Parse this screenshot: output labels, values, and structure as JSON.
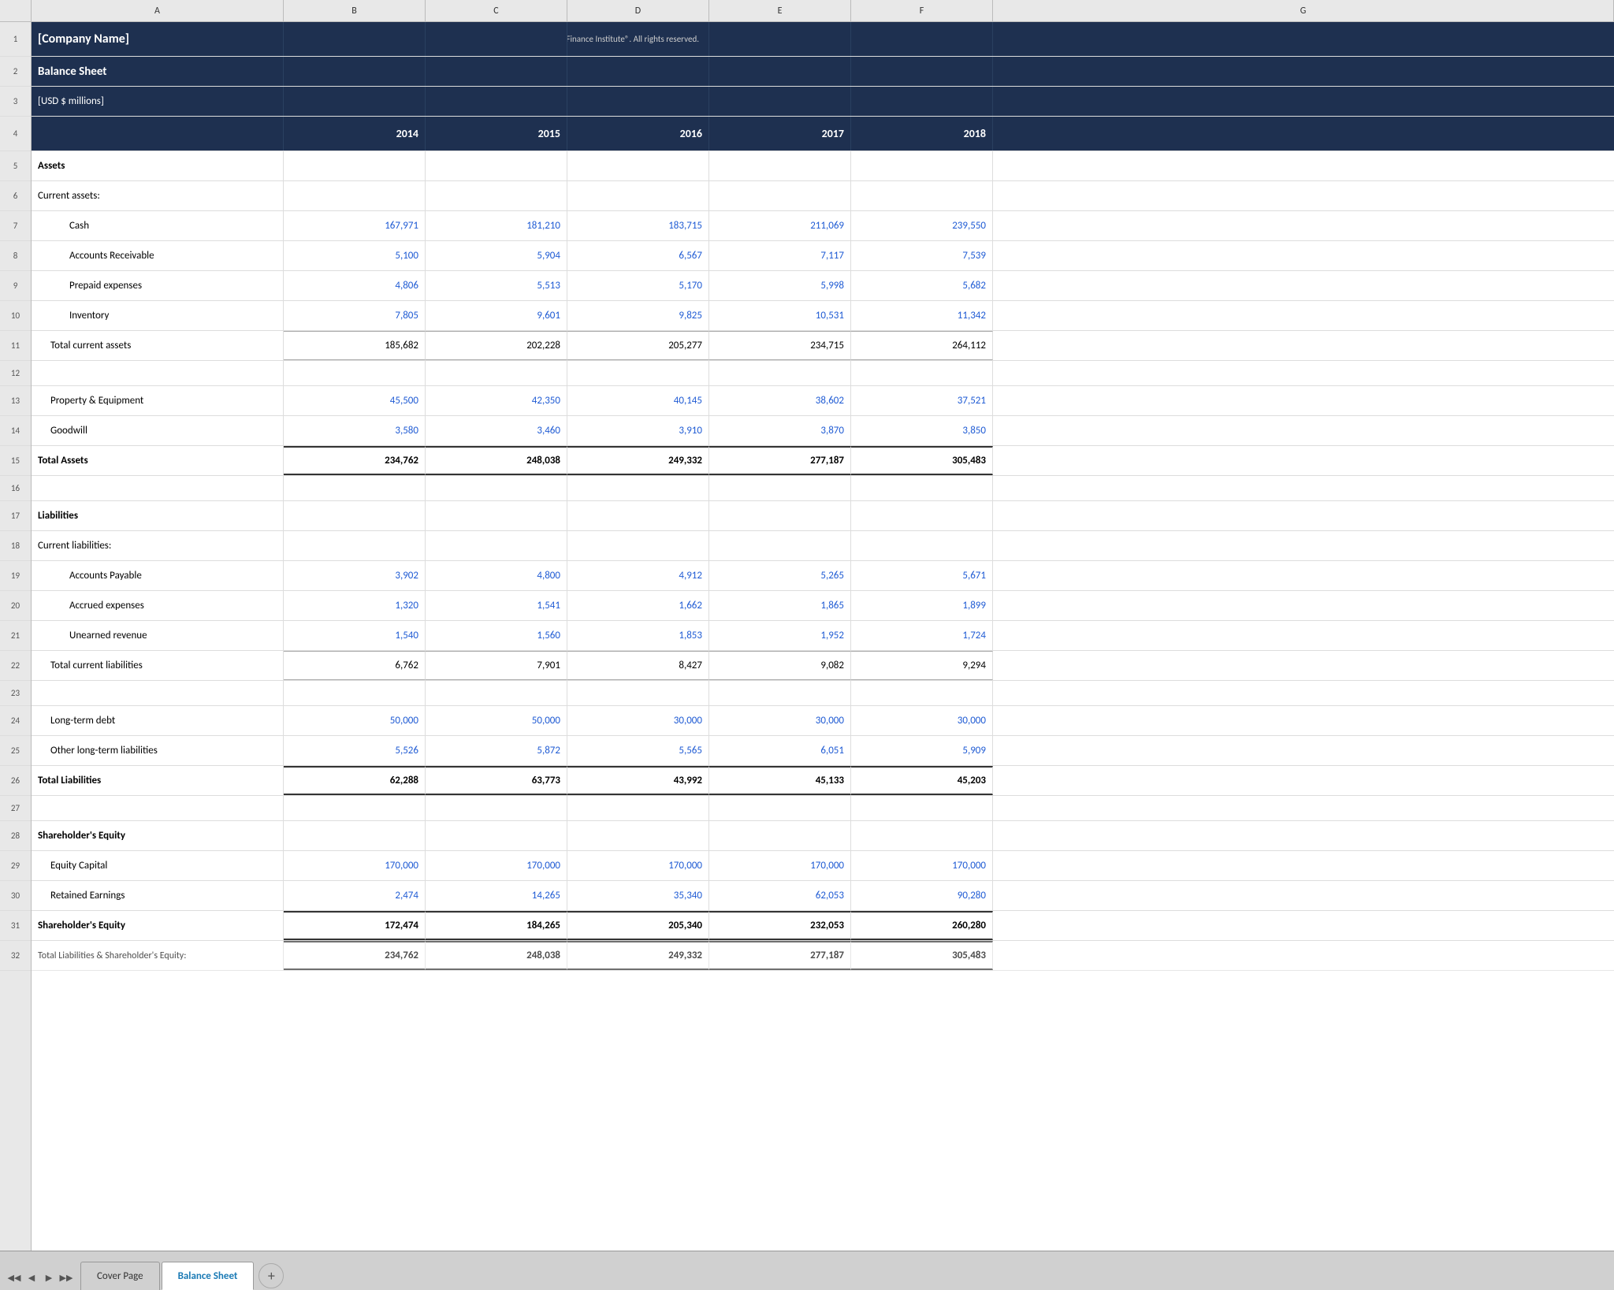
{
  "company": {
    "name": "[Company Name]",
    "copyright": "© Corporate Finance Institute®. All rights reserved.",
    "title": "Balance Sheet",
    "currency": "[USD $ millions]"
  },
  "columns": {
    "headers": [
      "A",
      "B",
      "C",
      "D",
      "E",
      "F",
      "G"
    ],
    "years": [
      "2014",
      "2015",
      "2016",
      "2017",
      "2018"
    ]
  },
  "rows": [
    {
      "num": "1",
      "height": "h-row-1"
    },
    {
      "num": "2",
      "height": "h-row-2"
    },
    {
      "num": "3",
      "height": "h-row-3"
    },
    {
      "num": "4",
      "height": "h-row-4"
    },
    {
      "num": "5",
      "height": "h-row-default"
    },
    {
      "num": "6",
      "height": "h-row-default"
    },
    {
      "num": "7",
      "height": "h-row-default"
    },
    {
      "num": "8",
      "height": "h-row-default"
    },
    {
      "num": "9",
      "height": "h-row-default"
    },
    {
      "num": "10",
      "height": "h-row-default"
    },
    {
      "num": "11",
      "height": "h-row-default"
    },
    {
      "num": "12",
      "height": "h-row-empty"
    },
    {
      "num": "13",
      "height": "h-row-default"
    },
    {
      "num": "14",
      "height": "h-row-default"
    },
    {
      "num": "15",
      "height": "h-row-default"
    },
    {
      "num": "16",
      "height": "h-row-empty"
    },
    {
      "num": "17",
      "height": "h-row-default"
    },
    {
      "num": "18",
      "height": "h-row-default"
    },
    {
      "num": "19",
      "height": "h-row-default"
    },
    {
      "num": "20",
      "height": "h-row-default"
    },
    {
      "num": "21",
      "height": "h-row-default"
    },
    {
      "num": "22",
      "height": "h-row-default"
    },
    {
      "num": "23",
      "height": "h-row-empty"
    },
    {
      "num": "24",
      "height": "h-row-default"
    },
    {
      "num": "25",
      "height": "h-row-default"
    },
    {
      "num": "26",
      "height": "h-row-default"
    },
    {
      "num": "27",
      "height": "h-row-empty"
    },
    {
      "num": "28",
      "height": "h-row-default"
    },
    {
      "num": "29",
      "height": "h-row-default"
    },
    {
      "num": "30",
      "height": "h-row-default"
    },
    {
      "num": "31",
      "height": "h-row-default"
    },
    {
      "num": "32",
      "height": "h-row-default"
    }
  ],
  "data": {
    "assets_label": "Assets",
    "current_assets_label": "Current assets:",
    "cash_label": "Cash",
    "ar_label": "Accounts Receivable",
    "prepaid_label": "Prepaid expenses",
    "inventory_label": "Inventory",
    "total_current_assets_label": "Total current assets",
    "ppe_label": "Property & Equipment",
    "goodwill_label": "Goodwill",
    "total_assets_label": "Total Assets",
    "liabilities_label": "Liabilities",
    "current_liabilities_label": "Current liabilities:",
    "ap_label": "Accounts Payable",
    "accrued_label": "Accrued expenses",
    "unearned_label": "Unearned revenue",
    "total_current_liabilities_label": "Total current liabilities",
    "ltd_label": "Long-term debt",
    "other_ltd_label": "Other long-term liabilities",
    "total_liabilities_label": "Total Liabilities",
    "se_heading_label": "Shareholder's Equity",
    "equity_capital_label": "Equity Capital",
    "retained_earnings_label": "Retained Earnings",
    "se_total_label": "Shareholder's Equity",
    "total_le_label": "Total Liabilities & Shareholder's Equity:",
    "cash": [
      "167,971",
      "181,210",
      "183,715",
      "211,069",
      "239,550"
    ],
    "ar": [
      "5,100",
      "5,904",
      "6,567",
      "7,117",
      "7,539"
    ],
    "prepaid": [
      "4,806",
      "5,513",
      "5,170",
      "5,998",
      "5,682"
    ],
    "inventory": [
      "7,805",
      "9,601",
      "9,825",
      "10,531",
      "11,342"
    ],
    "total_current_assets": [
      "185,682",
      "202,228",
      "205,277",
      "234,715",
      "264,112"
    ],
    "ppe": [
      "45,500",
      "42,350",
      "40,145",
      "38,602",
      "37,521"
    ],
    "goodwill": [
      "3,580",
      "3,460",
      "3,910",
      "3,870",
      "3,850"
    ],
    "total_assets": [
      "234,762",
      "248,038",
      "249,332",
      "277,187",
      "305,483"
    ],
    "ap": [
      "3,902",
      "4,800",
      "4,912",
      "5,265",
      "5,671"
    ],
    "accrued": [
      "1,320",
      "1,541",
      "1,662",
      "1,865",
      "1,899"
    ],
    "unearned": [
      "1,540",
      "1,560",
      "1,853",
      "1,952",
      "1,724"
    ],
    "total_current_liabilities": [
      "6,762",
      "7,901",
      "8,427",
      "9,082",
      "9,294"
    ],
    "ltd": [
      "50,000",
      "50,000",
      "30,000",
      "30,000",
      "30,000"
    ],
    "other_ltd": [
      "5,526",
      "5,872",
      "5,565",
      "6,051",
      "5,909"
    ],
    "total_liabilities": [
      "62,288",
      "63,773",
      "43,992",
      "45,133",
      "45,203"
    ],
    "equity_capital": [
      "170,000",
      "170,000",
      "170,000",
      "170,000",
      "170,000"
    ],
    "retained_earnings": [
      "2,474",
      "14,265",
      "35,340",
      "62,053",
      "90,280"
    ],
    "se_total": [
      "172,474",
      "184,265",
      "205,340",
      "232,053",
      "260,280"
    ],
    "total_le": [
      "234,762",
      "248,038",
      "249,332",
      "277,187",
      "305,483"
    ]
  },
  "tabs": {
    "cover_page": "Cover Page",
    "balance_sheet": "Balance Sheet",
    "add_icon": "+"
  }
}
